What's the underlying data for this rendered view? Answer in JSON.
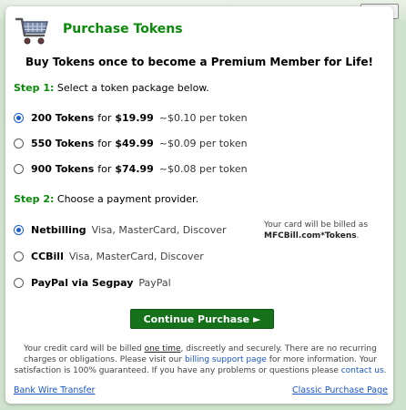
{
  "window": {
    "close_label": "Close"
  },
  "header": {
    "title": "Purchase Tokens",
    "icon": "shopping-cart-icon"
  },
  "tagline": "Buy Tokens once to become a Premium Member for Life!",
  "step1": {
    "label": "Step 1:",
    "text": "Select a token package below.",
    "packages": [
      {
        "tokens": "200 Tokens",
        "for": "for",
        "price": "$19.99",
        "per": "~$0.10 per token",
        "selected": true
      },
      {
        "tokens": "550 Tokens",
        "for": "for",
        "price": "$49.99",
        "per": "~$0.09 per token",
        "selected": false
      },
      {
        "tokens": "900 Tokens",
        "for": "for",
        "price": "$74.99",
        "per": "~$0.08 per token",
        "selected": false
      }
    ]
  },
  "step2": {
    "label": "Step 2:",
    "text": "Choose a payment provider.",
    "providers": [
      {
        "name": "Netbilling",
        "methods": "Visa, MasterCard, Discover",
        "selected": true
      },
      {
        "name": "CCBill",
        "methods": "Visa, MasterCard, Discover",
        "selected": false
      },
      {
        "name": "PayPal via Segpay",
        "methods": "PayPal",
        "selected": false
      }
    ],
    "billing_note": {
      "line1": "Your card will be billed as",
      "name": "MFCBill.com*Tokens",
      "suffix": "."
    }
  },
  "continue_label": "Continue Purchase ►",
  "fine_print": {
    "p1": "Your credit card will be billed ",
    "one_time": "one time",
    "p2": ", discreetly and securely. There are no recurring charges or obligations. Please visit our ",
    "support_link": "billing support page",
    "p3": " for more information. Your satisfaction is 100% guaranteed. If you have any problems or questions please ",
    "contact_link": "contact us",
    "p4": "."
  },
  "footer": {
    "left_link": "Bank Wire Transfer",
    "right_link": "Classic Purchase Page"
  },
  "colors": {
    "title_green": "#0a8a0a",
    "button_green": "#15721a",
    "link_blue": "#1a55c8",
    "radio_blue": "#1a5fd0"
  }
}
